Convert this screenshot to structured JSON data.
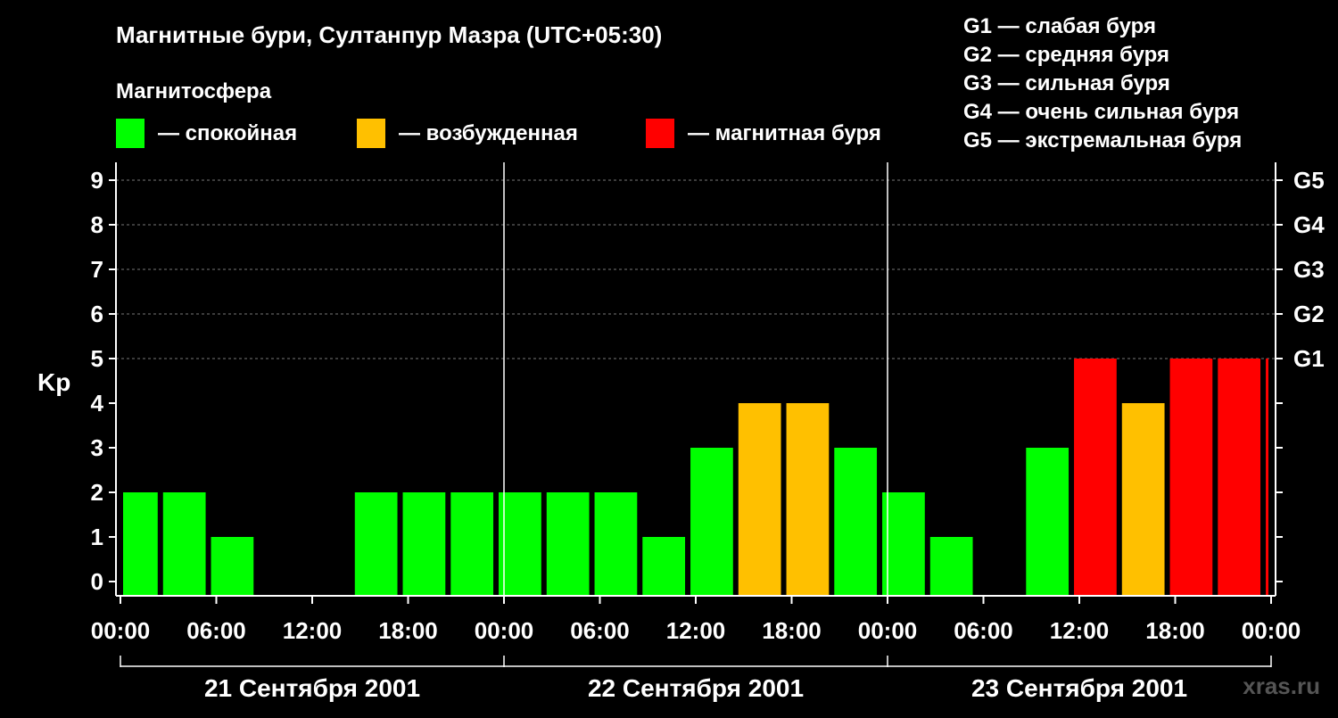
{
  "title": "Магнитные бури, Султанпур Мазра (UTC+05:30)",
  "legend": {
    "heading": "Магнитосфера",
    "items": [
      {
        "label": "— спокойная",
        "color": "#00ff00"
      },
      {
        "label": "— возбужденная",
        "color": "#ffc000"
      },
      {
        "label": "— магнитная буря",
        "color": "#ff0000"
      }
    ],
    "g_scale": [
      "G1 — слабая буря",
      "G2 — средняя буря",
      "G3 — сильная буря",
      "G4 — очень сильная буря",
      "G5 — экстремальная буря"
    ]
  },
  "watermark": "xras.ru",
  "chart_data": {
    "type": "bar",
    "ylabel": "Kp",
    "ylim": [
      0,
      9
    ],
    "yticks": [
      "0",
      "1",
      "2",
      "3",
      "4",
      "5",
      "6",
      "7",
      "8",
      "9"
    ],
    "right_ticks": [
      {
        "kp": 5,
        "label": "G1"
      },
      {
        "kp": 6,
        "label": "G2"
      },
      {
        "kp": 7,
        "label": "G3"
      },
      {
        "kp": 8,
        "label": "G4"
      },
      {
        "kp": 9,
        "label": "G5"
      }
    ],
    "x_hours_range": [
      0,
      72
    ],
    "xticks": [
      "00:00",
      "06:00",
      "12:00",
      "18:00",
      "00:00",
      "06:00",
      "12:00",
      "18:00",
      "00:00",
      "06:00",
      "12:00",
      "18:00",
      "00:00"
    ],
    "days": [
      "21 Сентября 2001",
      "22 Сентября 2001",
      "23 Сентября 2001"
    ],
    "bars": [
      {
        "start": 0,
        "end": 2.5,
        "kp": 2,
        "level": "quiet"
      },
      {
        "start": 2.5,
        "end": 5.5,
        "kp": 2,
        "level": "quiet"
      },
      {
        "start": 5.5,
        "end": 8.5,
        "kp": 1,
        "level": "quiet"
      },
      {
        "start": 8.5,
        "end": 11.5,
        "kp": 0,
        "level": "quiet"
      },
      {
        "start": 11.5,
        "end": 14.5,
        "kp": 0,
        "level": "quiet"
      },
      {
        "start": 14.5,
        "end": 17.5,
        "kp": 2,
        "level": "quiet"
      },
      {
        "start": 17.5,
        "end": 20.5,
        "kp": 2,
        "level": "quiet"
      },
      {
        "start": 20.5,
        "end": 23.5,
        "kp": 2,
        "level": "quiet"
      },
      {
        "start": 23.5,
        "end": 26.5,
        "kp": 2,
        "level": "quiet"
      },
      {
        "start": 26.5,
        "end": 29.5,
        "kp": 2,
        "level": "quiet"
      },
      {
        "start": 29.5,
        "end": 32.5,
        "kp": 2,
        "level": "quiet"
      },
      {
        "start": 32.5,
        "end": 35.5,
        "kp": 1,
        "level": "quiet"
      },
      {
        "start": 35.5,
        "end": 38.5,
        "kp": 3,
        "level": "quiet"
      },
      {
        "start": 38.5,
        "end": 41.5,
        "kp": 4,
        "level": "active"
      },
      {
        "start": 41.5,
        "end": 44.5,
        "kp": 4,
        "level": "active"
      },
      {
        "start": 44.5,
        "end": 47.5,
        "kp": 3,
        "level": "quiet"
      },
      {
        "start": 47.5,
        "end": 50.5,
        "kp": 2,
        "level": "quiet"
      },
      {
        "start": 50.5,
        "end": 53.5,
        "kp": 1,
        "level": "quiet"
      },
      {
        "start": 53.5,
        "end": 56.5,
        "kp": 0,
        "level": "quiet"
      },
      {
        "start": 56.5,
        "end": 59.5,
        "kp": 3,
        "level": "quiet"
      },
      {
        "start": 59.5,
        "end": 62.5,
        "kp": 5,
        "level": "storm"
      },
      {
        "start": 62.5,
        "end": 65.5,
        "kp": 4,
        "level": "active"
      },
      {
        "start": 65.5,
        "end": 68.5,
        "kp": 5,
        "level": "storm"
      },
      {
        "start": 68.5,
        "end": 71.5,
        "kp": 5,
        "level": "storm"
      },
      {
        "start": 71.5,
        "end": 72,
        "kp": 5,
        "level": "storm"
      }
    ]
  }
}
